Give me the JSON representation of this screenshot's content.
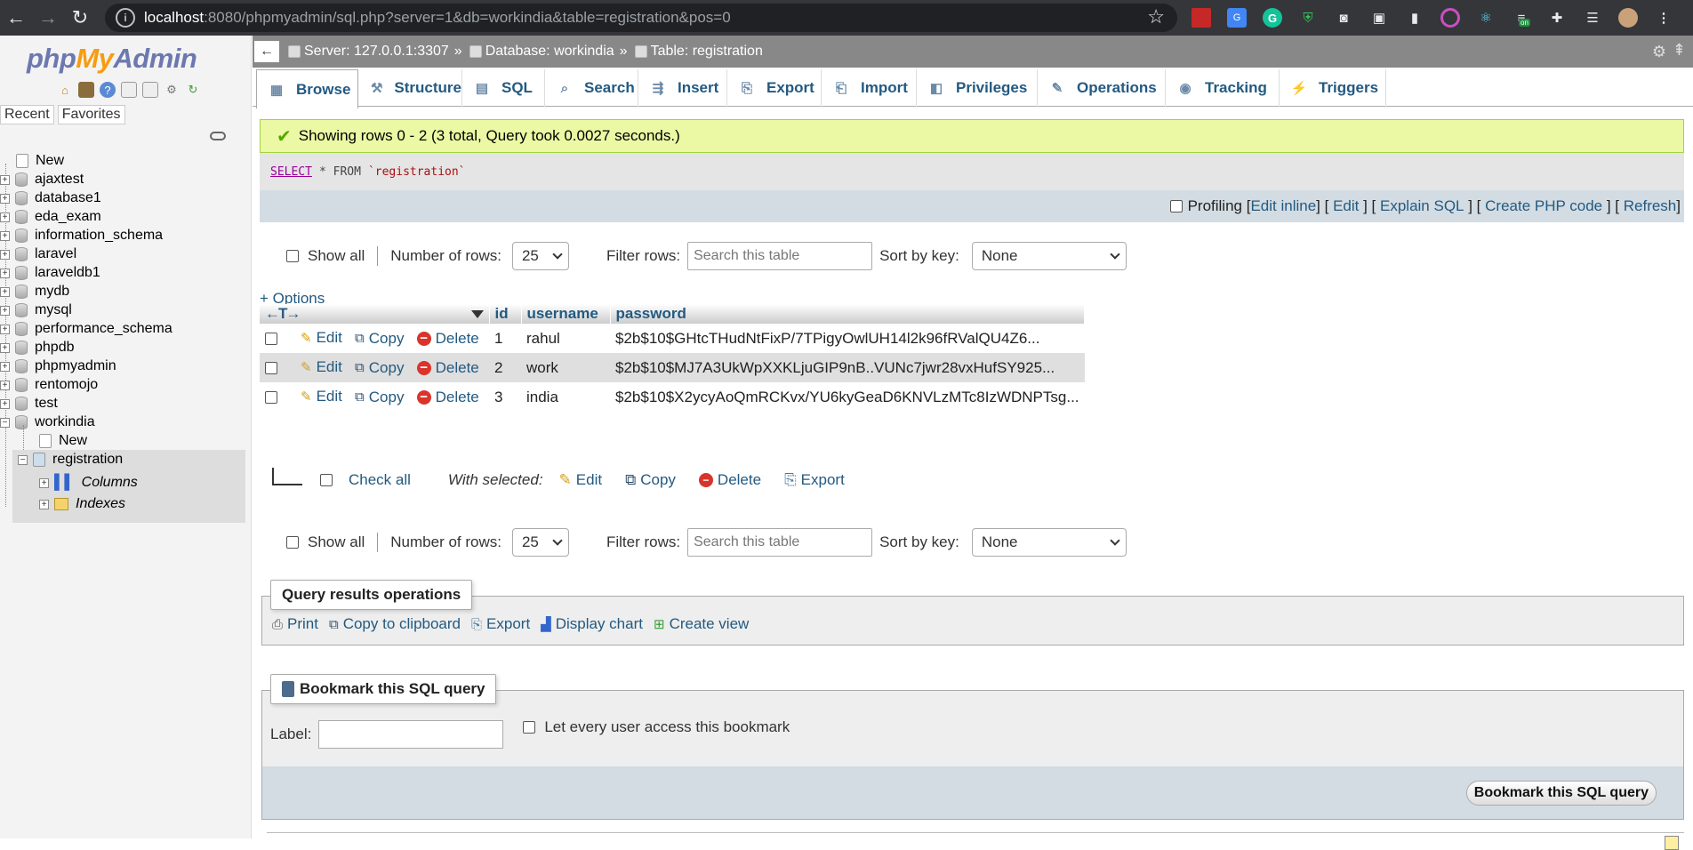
{
  "browser": {
    "url_host": "localhost",
    "url_path": ":8080/phpmyadmin/sql.php?server=1&db=workindia&table=registration&pos=0",
    "ext_badge": "on"
  },
  "nav": {
    "logo": {
      "php": "php",
      "my": "My",
      "admin": "Admin"
    },
    "tabs": [
      "Recent",
      "Favorites"
    ],
    "databases": [
      "New",
      "ajaxtest",
      "database1",
      "eda_exam",
      "information_schema",
      "laravel",
      "laraveldb1",
      "mydb",
      "mysql",
      "performance_schema",
      "phpdb",
      "phpmyadmin",
      "rentomojo",
      "test",
      "workindia"
    ],
    "workindia_children": {
      "new": "New",
      "table": "registration",
      "columns": "Columns",
      "indexes": "Indexes"
    }
  },
  "breadcrumb": {
    "server": "Server: 127.0.0.1:3307",
    "database": "Database: workindia",
    "table": "Table: registration",
    "sep": "»"
  },
  "tabs": [
    "Browse",
    "Structure",
    "SQL",
    "Search",
    "Insert",
    "Export",
    "Import",
    "Privileges",
    "Operations",
    "Tracking",
    "Triggers"
  ],
  "result": {
    "message": "Showing rows 0 - 2 (3 total, Query took 0.0027 seconds.)",
    "sql_keyword": "SELECT",
    "sql_rest": "* FROM",
    "sql_table": "`registration`"
  },
  "profiling": {
    "label": "Profiling",
    "links": [
      "Edit inline",
      "Edit",
      "Explain SQL",
      "Create PHP code",
      "Refresh"
    ]
  },
  "filters": {
    "show_all": "Show all",
    "num_rows_label": "Number of rows:",
    "num_rows_value": "25",
    "filter_label": "Filter rows:",
    "filter_placeholder": "Search this table",
    "sort_label": "Sort by key:",
    "sort_value": "None"
  },
  "options_link": "+ Options",
  "table": {
    "columns": [
      "id",
      "username",
      "password"
    ],
    "rows": [
      {
        "id": "1",
        "username": "rahul",
        "password": "$2b$10$GHtcTHudNtFixP/7TPigyOwlUH14l2k96fRValQU4Z6..."
      },
      {
        "id": "2",
        "username": "work",
        "password": "$2b$10$MJ7A3UkWpXXKLjuGIP9nB..VUNc7jwr28vxHufSY925..."
      },
      {
        "id": "3",
        "username": "india",
        "password": "$2b$10$X2ycyAoQmRCKvx/YU6kyGeaD6KNVLzMTc8IzWDNPTsg..."
      }
    ],
    "actions": {
      "edit": "Edit",
      "copy": "Copy",
      "delete": "Delete"
    }
  },
  "with_selected": {
    "check_all": "Check all",
    "label": "With selected:",
    "edit": "Edit",
    "copy": "Copy",
    "delete": "Delete",
    "export": "Export"
  },
  "query_ops": {
    "title": "Query results operations",
    "links": [
      "Print",
      "Copy to clipboard",
      "Export",
      "Display chart",
      "Create view"
    ]
  },
  "bookmark": {
    "title": "Bookmark this SQL query",
    "label": "Label:",
    "access": "Let every user access this bookmark",
    "button": "Bookmark this SQL query"
  }
}
